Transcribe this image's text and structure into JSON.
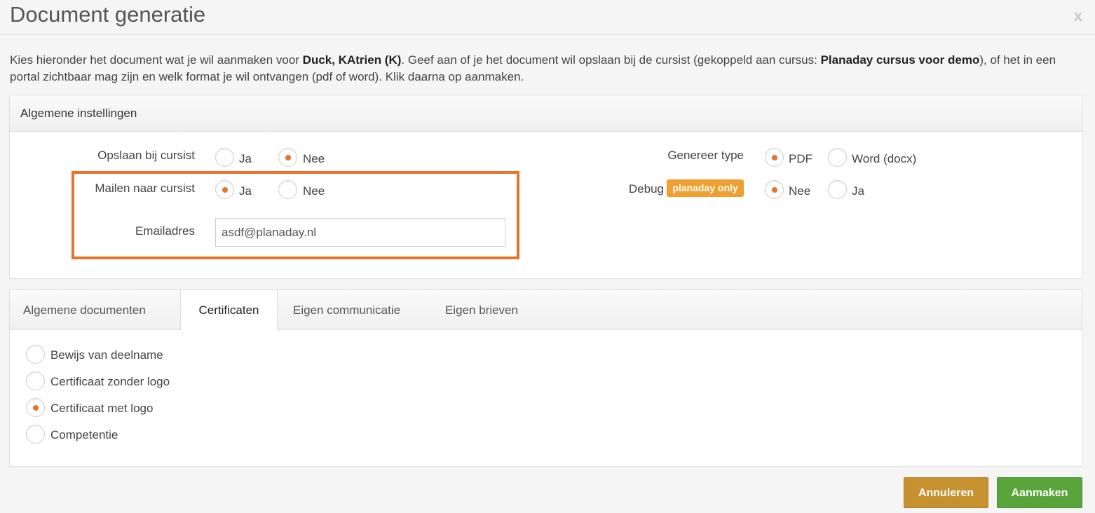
{
  "dialog": {
    "title": "Document generatie",
    "close_label": "x"
  },
  "intro": {
    "part1": "Kies hieronder het document wat je wil aanmaken voor ",
    "student": "Duck, KAtrien (K)",
    "part2": ". Geef aan of je het document wil opslaan bij de cursist (gekoppeld aan cursus: ",
    "course": "Planaday cursus voor demo",
    "part3": "), of het in een portal zichtbaar mag zijn en welk format je wil ontvangen (pdf of word). Klik daarna op aanmaken."
  },
  "general": {
    "heading": "Algemene instellingen",
    "save": {
      "label": "Opslaan bij cursist",
      "opt_yes": "Ja",
      "opt_no": "Nee",
      "selected": "Nee"
    },
    "mail": {
      "label": "Mailen naar cursist",
      "opt_yes": "Ja",
      "opt_no": "Nee",
      "selected": "Ja"
    },
    "email": {
      "label": "Emailadres",
      "value": "asdf@planaday.nl"
    },
    "type": {
      "label": "Genereer type",
      "opt_pdf": "PDF",
      "opt_word": "Word (docx)",
      "selected": "PDF"
    },
    "debug": {
      "label": "Debug",
      "badge": "planaday only",
      "opt_no": "Nee",
      "opt_yes": "Ja",
      "selected": "Nee"
    }
  },
  "tabs": [
    "Algemene documenten",
    "Certificaten",
    "Eigen communicatie",
    "Eigen brieven"
  ],
  "active_tab": "Certificaten",
  "documents": [
    {
      "label": "Bewijs van deelname",
      "checked": false
    },
    {
      "label": "Certificaat zonder logo",
      "checked": false
    },
    {
      "label": "Certificaat met logo",
      "checked": true
    },
    {
      "label": "Competentie",
      "checked": false
    }
  ],
  "buttons": {
    "cancel": "Annuleren",
    "create": "Aanmaken"
  },
  "colors": {
    "accent": "#e8742a",
    "cancel": "#c8912f",
    "create": "#5aa43c",
    "badge": "#f0a030"
  }
}
